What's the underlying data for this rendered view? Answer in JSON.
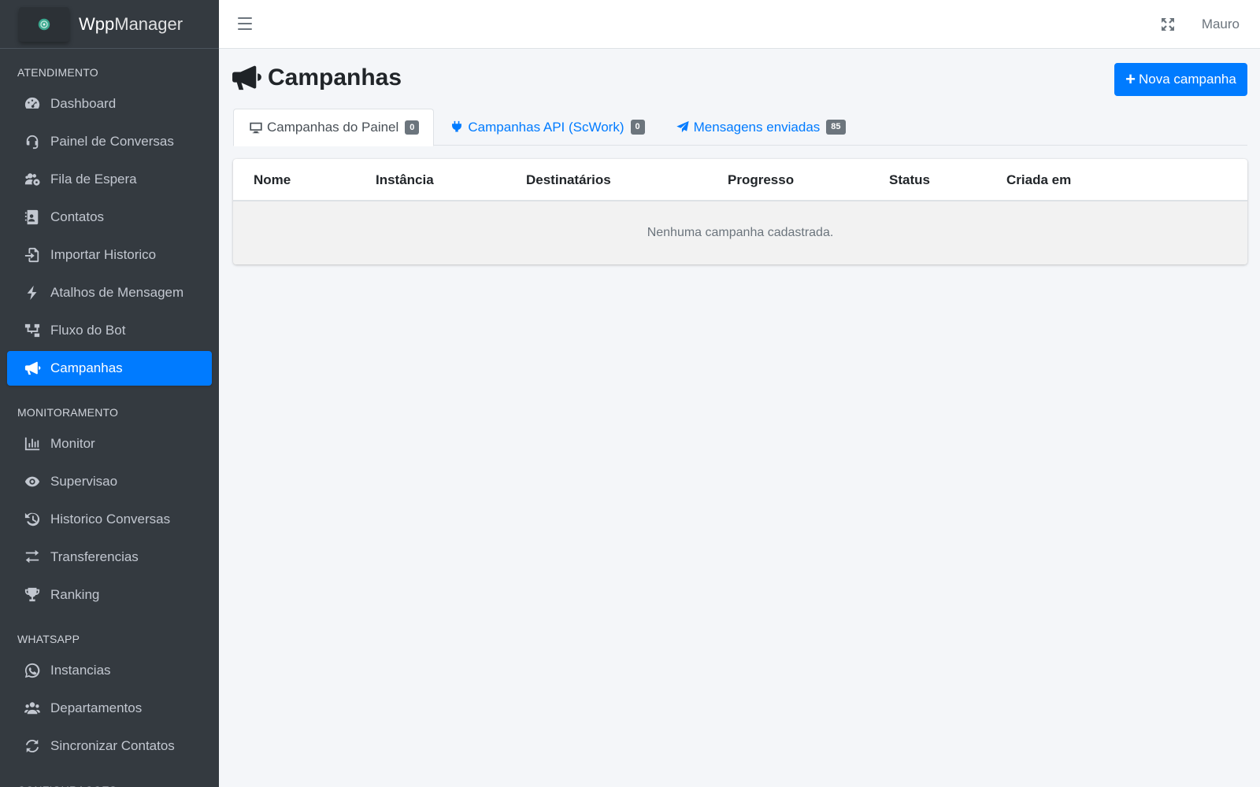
{
  "brand": {
    "name_bold": "Wpp",
    "name_light": "Manager"
  },
  "topbar": {
    "user": "Mauro"
  },
  "sidebar": {
    "sections": [
      {
        "title": "ATENDIMENTO",
        "items": [
          {
            "label": "Dashboard",
            "icon": "dashboard-icon"
          },
          {
            "label": "Painel de Conversas",
            "icon": "headset-icon"
          },
          {
            "label": "Fila de Espera",
            "icon": "users-cog-icon"
          },
          {
            "label": "Contatos",
            "icon": "address-book-icon"
          },
          {
            "label": "Importar Historico",
            "icon": "file-import-icon"
          },
          {
            "label": "Atalhos de Mensagem",
            "icon": "bolt-icon"
          },
          {
            "label": "Fluxo do Bot",
            "icon": "sitemap-icon"
          },
          {
            "label": "Campanhas",
            "icon": "bullhorn-icon",
            "active": true
          }
        ]
      },
      {
        "title": "MONITORAMENTO",
        "items": [
          {
            "label": "Monitor",
            "icon": "chart-bar-icon"
          },
          {
            "label": "Supervisao",
            "icon": "eye-icon"
          },
          {
            "label": "Historico Conversas",
            "icon": "history-icon"
          },
          {
            "label": "Transferencias",
            "icon": "exchange-icon"
          },
          {
            "label": "Ranking",
            "icon": "trophy-icon"
          }
        ]
      },
      {
        "title": "WHATSAPP",
        "items": [
          {
            "label": "Instancias",
            "icon": "whatsapp-icon"
          },
          {
            "label": "Departamentos",
            "icon": "users-icon"
          },
          {
            "label": "Sincronizar Contatos",
            "icon": "sync-icon"
          }
        ]
      },
      {
        "title": "CONFIGURACOES",
        "items": []
      }
    ]
  },
  "page": {
    "title": "Campanhas",
    "new_button": "Nova campanha"
  },
  "tabs": [
    {
      "label": "Campanhas do Painel",
      "badge": "0",
      "icon": "desktop-icon",
      "active": true
    },
    {
      "label": "Campanhas API (ScWork)",
      "badge": "0",
      "icon": "plug-icon"
    },
    {
      "label": "Mensagens enviadas",
      "badge": "85",
      "icon": "paper-plane-icon"
    }
  ],
  "table": {
    "columns": [
      "Nome",
      "Instância",
      "Destinatários",
      "Progresso",
      "Status",
      "Criada em"
    ],
    "empty_text": "Nenhuma campanha cadastrada."
  },
  "colors": {
    "sidebar_bg": "#343a40",
    "primary": "#007bff",
    "content_bg": "#f4f6f9"
  }
}
